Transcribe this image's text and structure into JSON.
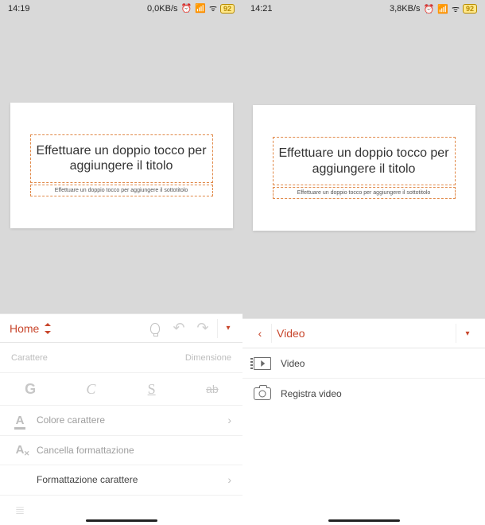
{
  "left": {
    "status": {
      "time": "14:19",
      "net": "0,0KB/s",
      "battery": "92"
    },
    "slide": {
      "title_placeholder": "Effettuare un doppio tocco per aggiungere il titolo",
      "subtitle_placeholder": "Effettuare un doppio tocco per aggiungere il sottotitolo"
    },
    "toolbar": {
      "tab": "Home"
    },
    "section": {
      "char_label": "Carattere",
      "size_label": "Dimensione"
    },
    "styles": {
      "bold": "G",
      "italic": "C",
      "underline": "S",
      "strike": "ab"
    },
    "rows": {
      "font_color": "Colore carattere",
      "clear_format": "Cancella formattazione",
      "char_format": "Formattazione carattere"
    }
  },
  "right": {
    "status": {
      "time": "14:21",
      "net": "3,8KB/s",
      "battery": "92"
    },
    "slide": {
      "title_placeholder": "Effettuare un doppio tocco per aggiungere il titolo",
      "subtitle_placeholder": "Effettuare un doppio tocco per aggiungere il sottotitolo"
    },
    "toolbar": {
      "tab": "Video"
    },
    "rows": {
      "video": "Video",
      "record": "Registra video"
    }
  }
}
